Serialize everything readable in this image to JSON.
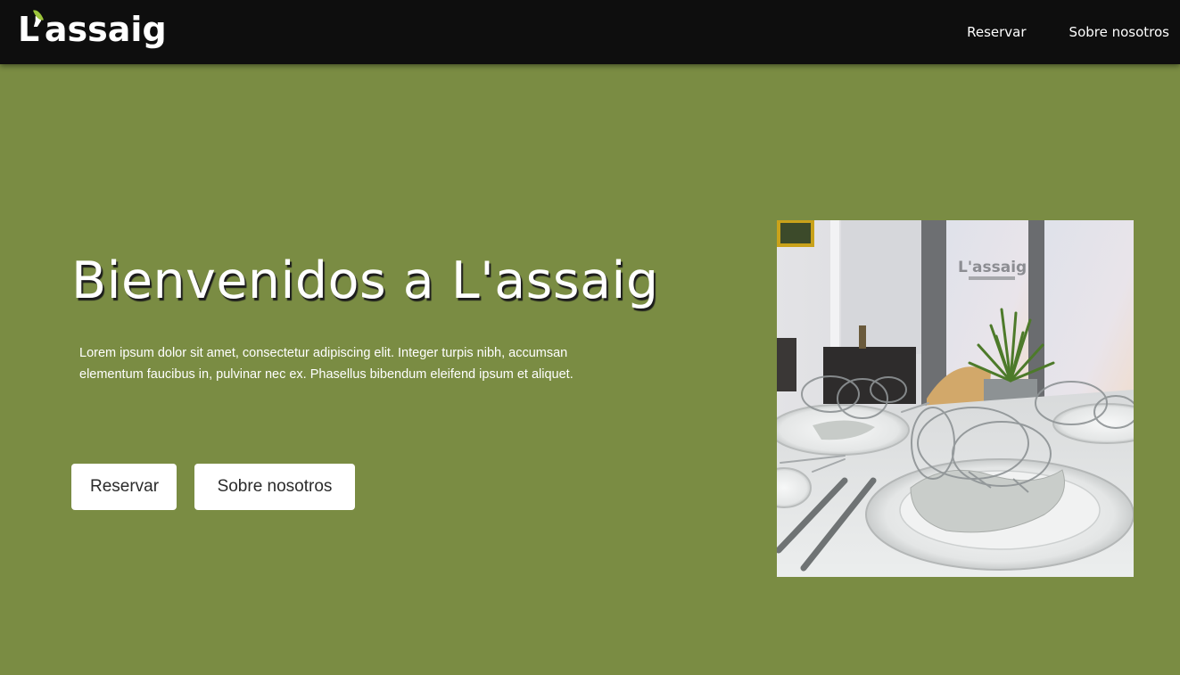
{
  "header": {
    "logo_text": "L’assaig",
    "nav": [
      {
        "label": "Reservar"
      },
      {
        "label": "Sobre nosotros"
      }
    ]
  },
  "hero": {
    "title": "Bienvenidos a L'assaig",
    "description": "Lorem ipsum dolor sit amet, consectetur adipiscing elit. Integer turpis nibh, accumsan elementum faucibus in, pulvinar nec ex. Phasellus bibendum eleifend ipsum et aliquet.",
    "buttons": {
      "reserve": "Reservar",
      "about": "Sobre nosotros"
    },
    "photo_window_text": "L'assaig"
  },
  "colors": {
    "background": "#7a8c43",
    "navbar": "#0e0e0e",
    "logo_accent": "#9cc43a",
    "button_bg": "#ffffff"
  }
}
